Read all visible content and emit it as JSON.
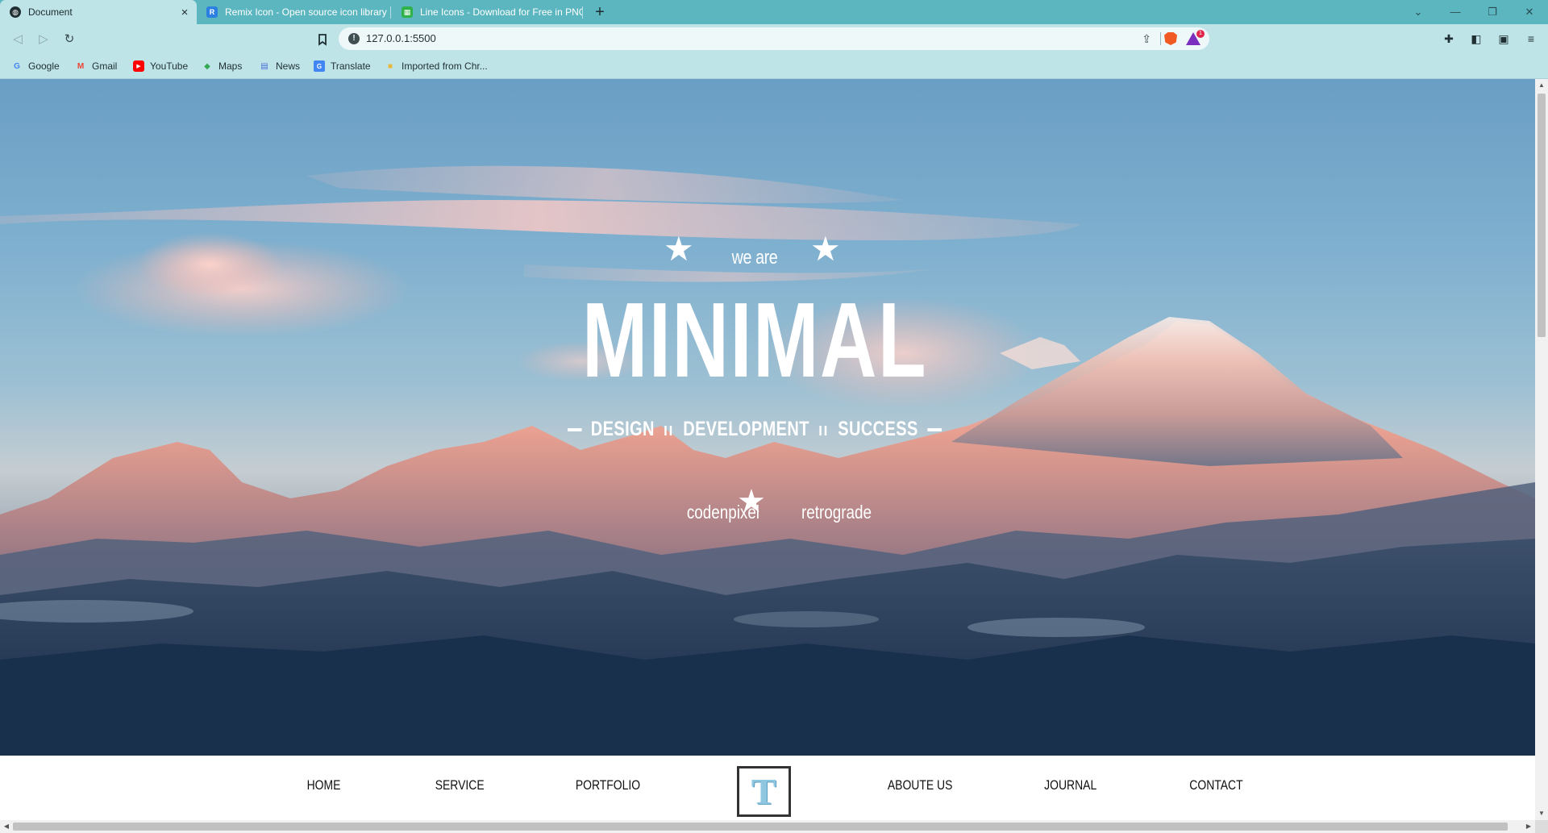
{
  "browser": {
    "tabs": [
      {
        "title": "Document",
        "active": true,
        "icon": "globe-icon"
      },
      {
        "title": "Remix Icon - Open source icon library",
        "active": false,
        "icon": "remix-favicon"
      },
      {
        "title": "Line Icons - Download for Free in PNG",
        "active": false,
        "icon": "lineicons-favicon"
      }
    ],
    "address": {
      "url": "127.0.0.1:5500"
    },
    "bookmarks": [
      {
        "label": "Google",
        "icon": "google-icon"
      },
      {
        "label": "Gmail",
        "icon": "gmail-icon"
      },
      {
        "label": "YouTube",
        "icon": "youtube-icon"
      },
      {
        "label": "Maps",
        "icon": "maps-icon"
      },
      {
        "label": "News",
        "icon": "news-icon"
      },
      {
        "label": "Translate",
        "icon": "translate-icon"
      },
      {
        "label": "Imported from Chr...",
        "icon": "folder-icon"
      }
    ],
    "rewards_badge": "1",
    "colors": {
      "tabbar": "#5bb6c0",
      "toolbar": "#bfe4e8"
    }
  },
  "hero": {
    "kicker": "we are",
    "title": "MINIMAL",
    "tagline": [
      "DESIGN",
      "DEVELOPMENT",
      "SUCCESS"
    ],
    "tagline_separator": "ıı",
    "sub_left": "codenpixel",
    "sub_right": "retrograde"
  },
  "nav": {
    "items": [
      "HOME",
      "SERVICE",
      "PORTFOLIO",
      "ABOUTE US",
      "JOURNAL",
      "CONTACT"
    ],
    "logo_letter": "T"
  }
}
